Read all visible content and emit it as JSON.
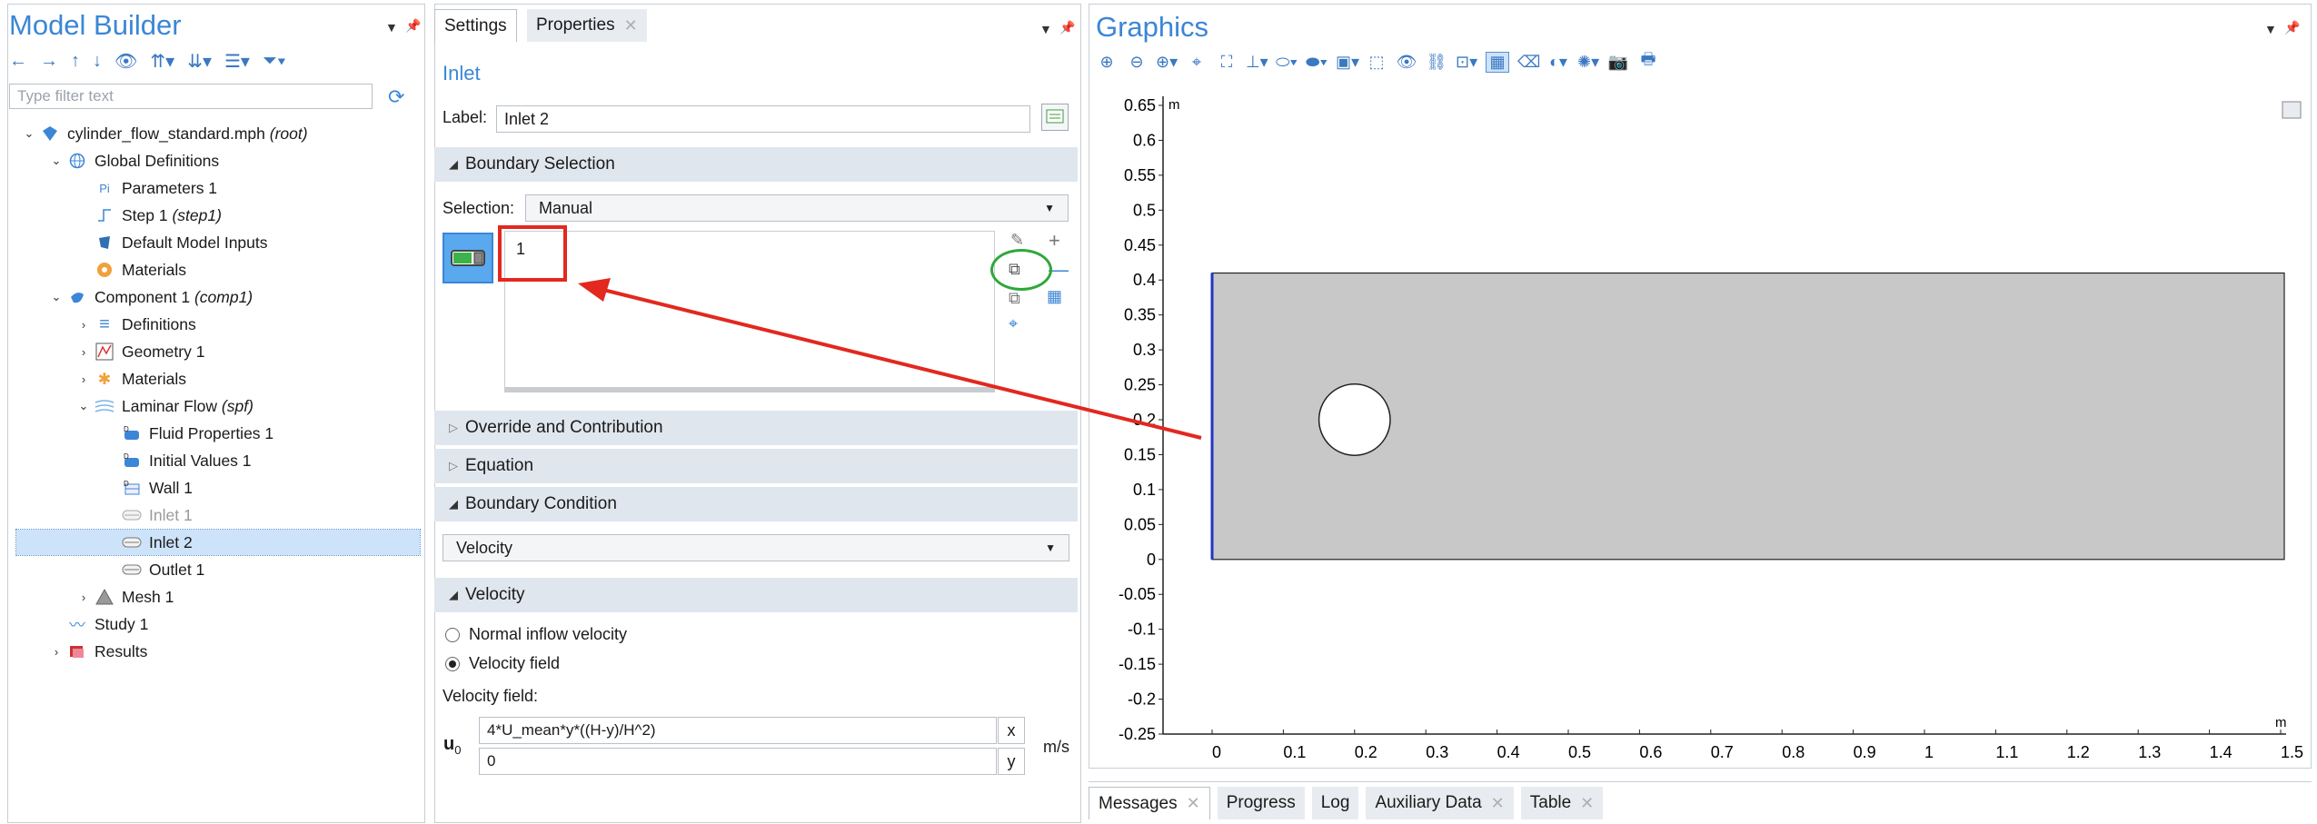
{
  "model_builder": {
    "title": "Model Builder",
    "filter_placeholder": "Type filter text",
    "tree": [
      {
        "label": "cylinder_flow_standard.mph",
        "suffix": "(root)",
        "icon": "model-icon"
      },
      {
        "label": "Global Definitions",
        "icon": "globe-icon"
      },
      {
        "label": "Parameters 1",
        "icon": "parameters-icon"
      },
      {
        "label": "Step 1",
        "suffix": "(step1)",
        "icon": "step-function-icon"
      },
      {
        "label": "Default Model Inputs",
        "icon": "model-inputs-icon"
      },
      {
        "label": "Materials",
        "icon": "materials-icon"
      },
      {
        "label": "Component 1",
        "suffix": "(comp1)",
        "icon": "component-icon"
      },
      {
        "label": "Definitions",
        "icon": "definitions-icon"
      },
      {
        "label": "Geometry 1",
        "icon": "geometry-icon"
      },
      {
        "label": "Materials",
        "icon": "materials-icon"
      },
      {
        "label": "Laminar Flow",
        "suffix": "(spf)",
        "icon": "laminar-flow-icon"
      },
      {
        "label": "Fluid Properties 1",
        "icon": "fluid-properties-icon"
      },
      {
        "label": "Initial Values 1",
        "icon": "initial-values-icon"
      },
      {
        "label": "Wall 1",
        "icon": "wall-icon"
      },
      {
        "label": "Inlet 1",
        "icon": "inlet-icon"
      },
      {
        "label": "Inlet 2",
        "icon": "inlet-icon"
      },
      {
        "label": "Outlet 1",
        "icon": "outlet-icon"
      },
      {
        "label": "Mesh 1",
        "icon": "mesh-icon"
      },
      {
        "label": "Study 1",
        "icon": "study-icon"
      },
      {
        "label": "Results",
        "icon": "results-icon"
      }
    ]
  },
  "settings": {
    "tabs": [
      "Settings",
      "Properties"
    ],
    "title": "Inlet",
    "label_caption": "Label:",
    "label_value": "Inlet 2",
    "sections": {
      "boundary_selection": "Boundary Selection",
      "override": "Override and Contribution",
      "equation": "Equation",
      "boundary_condition": "Boundary Condition",
      "velocity": "Velocity"
    },
    "selection_caption": "Selection:",
    "selection_value": "Manual",
    "selection_items": [
      "1"
    ],
    "boundary_condition_value": "Velocity",
    "radio_normal": "Normal inflow velocity",
    "radio_field": "Velocity field",
    "velocity_field_caption": "Velocity field:",
    "u0_symbol": "u",
    "u0_sub": "0",
    "u0_x": "4*U_mean*y*((H-y)/H^2)",
    "u0_y": "0",
    "comp_x": "x",
    "comp_y": "y",
    "unit": "m/s"
  },
  "graphics": {
    "title": "Graphics",
    "unit_y": "m",
    "unit_x": "m",
    "chart_data": {
      "type": "geometry",
      "xlim": [
        0,
        1.5
      ],
      "ylim": [
        -0.25,
        0.65
      ],
      "x_ticks": [
        "0",
        "0.1",
        "0.2",
        "0.3",
        "0.4",
        "0.5",
        "0.6",
        "0.7",
        "0.8",
        "0.9",
        "1",
        "1.1",
        "1.2",
        "1.3",
        "1.4",
        "1.5"
      ],
      "y_ticks": [
        "0.65",
        "0.6",
        "0.55",
        "0.5",
        "0.45",
        "0.4",
        "0.35",
        "0.3",
        "0.25",
        "0.2",
        "0.15",
        "0.1",
        "0.05",
        "0",
        "-0.05",
        "-0.1",
        "-0.15",
        "-0.2",
        "-0.25"
      ],
      "channel": {
        "x0": 0,
        "x1": 1.5,
        "y0": 0,
        "y1": 0.41
      },
      "cylinder": {
        "cx": 0.2,
        "cy": 0.2,
        "r": 0.05
      },
      "highlight_boundary": "left edge x=0",
      "colors": {
        "domain": "#c8c8c8",
        "highlight": "#1f35c8",
        "annotation": "#e2281f",
        "ellipse": "#2ea83a"
      }
    }
  },
  "bottom_tabs": [
    "Messages",
    "Progress",
    "Log",
    "Auxiliary Data",
    "Table"
  ]
}
